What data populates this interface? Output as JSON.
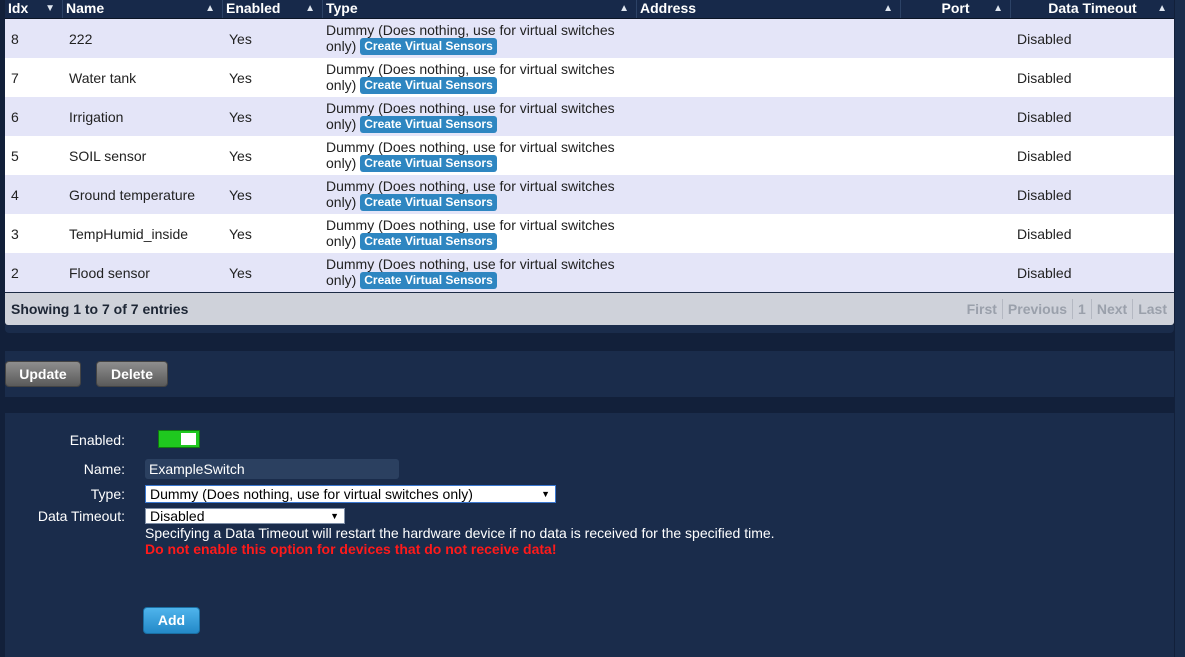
{
  "table": {
    "headers": {
      "idx": "Idx",
      "name": "Name",
      "enabled": "Enabled",
      "type": "Type",
      "address": "Address",
      "port": "Port",
      "data_timeout": "Data Timeout"
    },
    "rows": [
      {
        "idx": "8",
        "name": "222",
        "enabled": "Yes",
        "type": "Dummy (Does nothing, use for virtual switches only)",
        "action": "Create Virtual Sensors",
        "address": "",
        "port": "",
        "data_timeout": "Disabled"
      },
      {
        "idx": "7",
        "name": "Water tank",
        "enabled": "Yes",
        "type": "Dummy (Does nothing, use for virtual switches only)",
        "action": "Create Virtual Sensors",
        "address": "",
        "port": "",
        "data_timeout": "Disabled"
      },
      {
        "idx": "6",
        "name": "Irrigation",
        "enabled": "Yes",
        "type": "Dummy (Does nothing, use for virtual switches only)",
        "action": "Create Virtual Sensors",
        "address": "",
        "port": "",
        "data_timeout": "Disabled"
      },
      {
        "idx": "5",
        "name": "SOIL sensor",
        "enabled": "Yes",
        "type": "Dummy (Does nothing, use for virtual switches only)",
        "action": "Create Virtual Sensors",
        "address": "",
        "port": "",
        "data_timeout": "Disabled"
      },
      {
        "idx": "4",
        "name": "Ground temperature",
        "enabled": "Yes",
        "type": "Dummy (Does nothing, use for virtual switches only)",
        "action": "Create Virtual Sensors",
        "address": "",
        "port": "",
        "data_timeout": "Disabled"
      },
      {
        "idx": "3",
        "name": "TempHumid_inside",
        "enabled": "Yes",
        "type": "Dummy (Does nothing, use for virtual switches only)",
        "action": "Create Virtual Sensors",
        "address": "",
        "port": "",
        "data_timeout": "Disabled"
      },
      {
        "idx": "2",
        "name": "Flood sensor",
        "enabled": "Yes",
        "type": "Dummy (Does nothing, use for virtual switches only)",
        "action": "Create Virtual Sensors",
        "address": "",
        "port": "",
        "data_timeout": "Disabled"
      }
    ],
    "info": "Showing 1 to 7 of 7 entries",
    "pager": {
      "first": "First",
      "previous": "Previous",
      "page": "1",
      "next": "Next",
      "last": "Last"
    }
  },
  "actions": {
    "update": "Update",
    "delete": "Delete"
  },
  "form": {
    "enabled_label": "Enabled:",
    "enabled_value": true,
    "name_label": "Name:",
    "name_value": "ExampleSwitch",
    "type_label": "Type:",
    "type_value": "Dummy (Does nothing, use for virtual switches only)",
    "timeout_label": "Data Timeout:",
    "timeout_value": "Disabled",
    "timeout_note": "Specifying a Data Timeout will restart the hardware device if no data is received for the specified time.",
    "timeout_warning": "Do not enable this option for devices that do not receive data!",
    "add_label": "Add"
  },
  "colors": {
    "accent": "#2e86c1",
    "toggle_on": "#1fc81f",
    "warning": "#ff1a1a",
    "panel": "#1a2c4b"
  }
}
